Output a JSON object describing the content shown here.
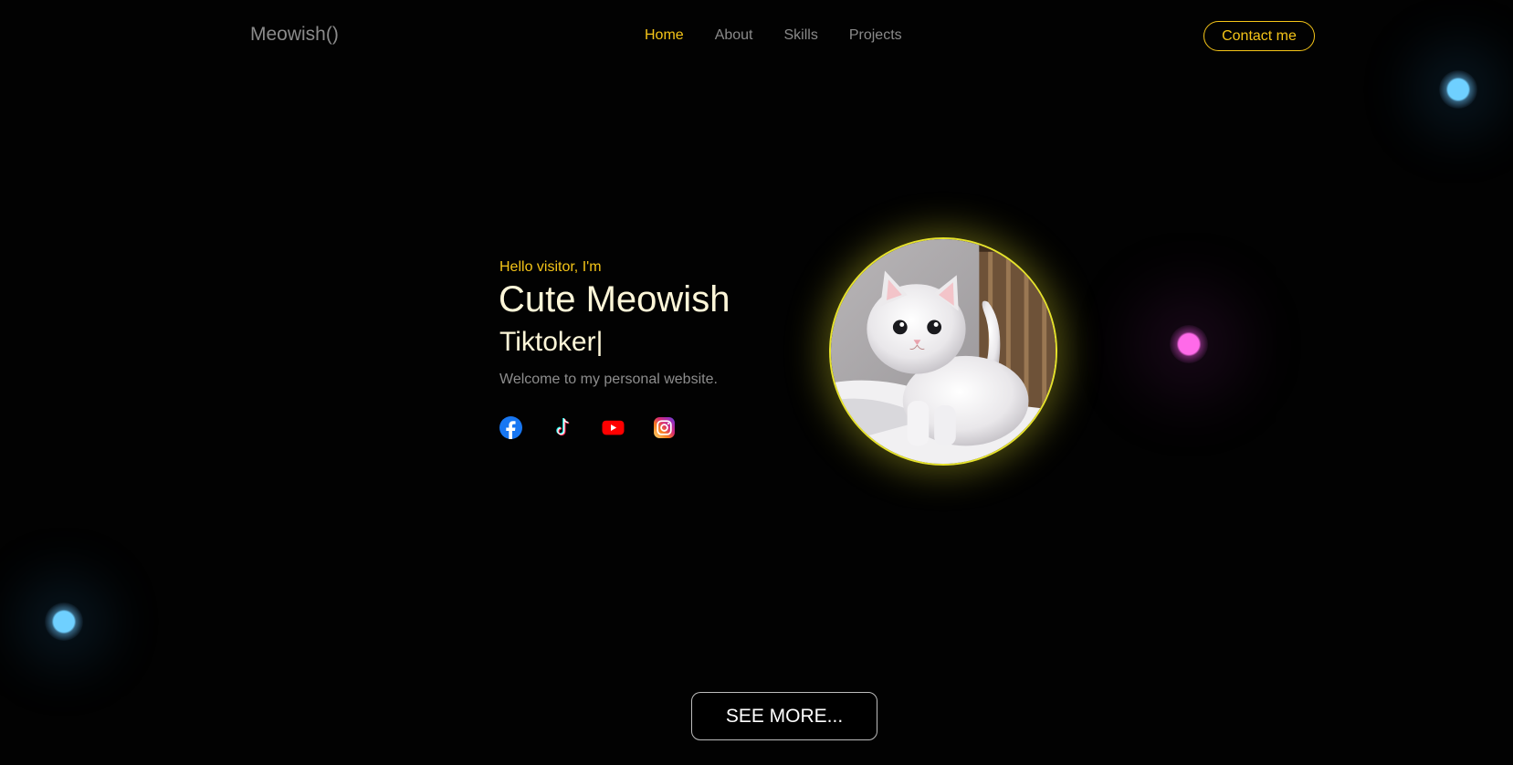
{
  "header": {
    "logo": "Meowish()",
    "nav": [
      {
        "label": "Home",
        "active": true
      },
      {
        "label": "About",
        "active": false
      },
      {
        "label": "Skills",
        "active": false
      },
      {
        "label": "Projects",
        "active": false
      }
    ],
    "contact_label": "Contact me"
  },
  "hero": {
    "greeting": "Hello visitor, I'm",
    "name": "Cute Meowish",
    "role": "Tiktoker",
    "cursor": "|",
    "description": "Welcome to my personal website."
  },
  "socials": [
    {
      "name": "facebook-icon",
      "color": "#1877f2"
    },
    {
      "name": "tiktok-icon",
      "color": "#25f4ee"
    },
    {
      "name": "youtube-icon",
      "color": "#ff0000"
    },
    {
      "name": "instagram-icon",
      "color": "#e1306c"
    }
  ],
  "see_more_label": "SEE MORE...",
  "colors": {
    "accent": "#f5c518",
    "background": "#020202",
    "avatar_ring": "#e6e22c",
    "orb_blue": "#6fd0ff",
    "orb_pink": "#ff6ae9"
  }
}
